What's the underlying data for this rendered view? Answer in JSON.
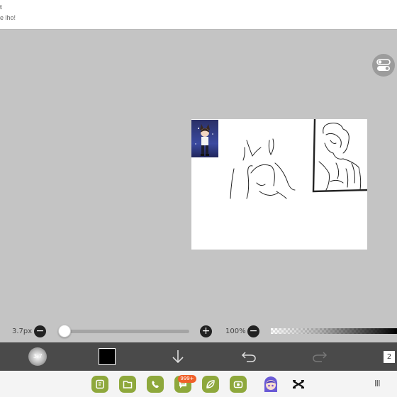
{
  "notification": {
    "title_fragment": "t",
    "body_fragment": "e lho!"
  },
  "brush": {
    "size_label": "3.7px",
    "size_level": 0.03,
    "preview_value": "3.7"
  },
  "opacity": {
    "label": "100%",
    "level": 1.0
  },
  "toolbar": {
    "color_value": "#000000",
    "layer_count": "2"
  },
  "dock": {
    "apps": [
      "notes-app",
      "files-app",
      "phone-app",
      "messages-app",
      "leaf-app",
      "camera-app",
      "avatar-app",
      "capcut-app"
    ],
    "messages_badge": "999+",
    "recent_glyph": "III"
  },
  "colors": {
    "workspace_bg": "#c4c4c4",
    "toolbar_bg": "#4a4a4a",
    "app_green": "#8ea83c",
    "badge_orange": "#f0602a"
  }
}
